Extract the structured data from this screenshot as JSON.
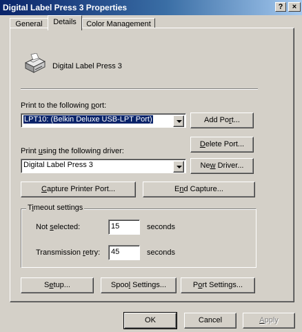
{
  "window": {
    "title": "Digital Label Press 3 Properties",
    "help_button": "?",
    "close_button": "×"
  },
  "tabs": [
    {
      "label": "General",
      "active": false
    },
    {
      "label": "Details",
      "active": true
    },
    {
      "label": "Color Management",
      "active": false
    }
  ],
  "printer": {
    "name": "Digital Label Press 3",
    "icon": "printer-icon"
  },
  "port": {
    "label_pre": "Print to the following ",
    "label_key": "p",
    "label_post": "ort:",
    "value": "LPT10:  (Belkin Deluxe USB-LPT Port)",
    "add_port": {
      "pre": "Add Po",
      "key": "r",
      "post": "t..."
    },
    "delete_port": {
      "pre": "",
      "key": "D",
      "post": "elete Port..."
    }
  },
  "driver": {
    "label_pre": "Print ",
    "label_key": "u",
    "label_post": "sing the following driver:",
    "value": "Digital Label Press 3",
    "new_driver": {
      "pre": "Ne",
      "key": "w",
      "post": " Driver..."
    }
  },
  "capture": {
    "capture_printer_port": {
      "pre": "",
      "key": "C",
      "post": "apture Printer Port..."
    },
    "end_capture": {
      "pre": "E",
      "key": "n",
      "post": "d Capture..."
    }
  },
  "timeout": {
    "title_pre": "T",
    "title_key": "i",
    "title_post": "meout settings",
    "not_selected": {
      "label_pre": "Not ",
      "label_key": "s",
      "label_post": "elected:",
      "value": "15",
      "unit": "seconds"
    },
    "transmission_retry": {
      "label_pre": "Transmission ",
      "label_key": "r",
      "label_post": "etry:",
      "value": "45",
      "unit": "seconds"
    }
  },
  "bottom_buttons": {
    "setup": {
      "pre": "S",
      "key": "e",
      "post": "tup..."
    },
    "spool_settings": {
      "pre": "Spoo",
      "key": "l",
      "post": " Settings..."
    },
    "port_settings": {
      "pre": "P",
      "key": "o",
      "post": "rt Settings..."
    }
  },
  "dialog_buttons": {
    "ok": "OK",
    "cancel": "Cancel",
    "apply": {
      "pre": "",
      "key": "A",
      "post": "pply"
    }
  },
  "colors": {
    "face": "#d4d0c8",
    "title_start": "#0a246a",
    "title_end": "#a6caf0",
    "selection": "#0a246a"
  }
}
